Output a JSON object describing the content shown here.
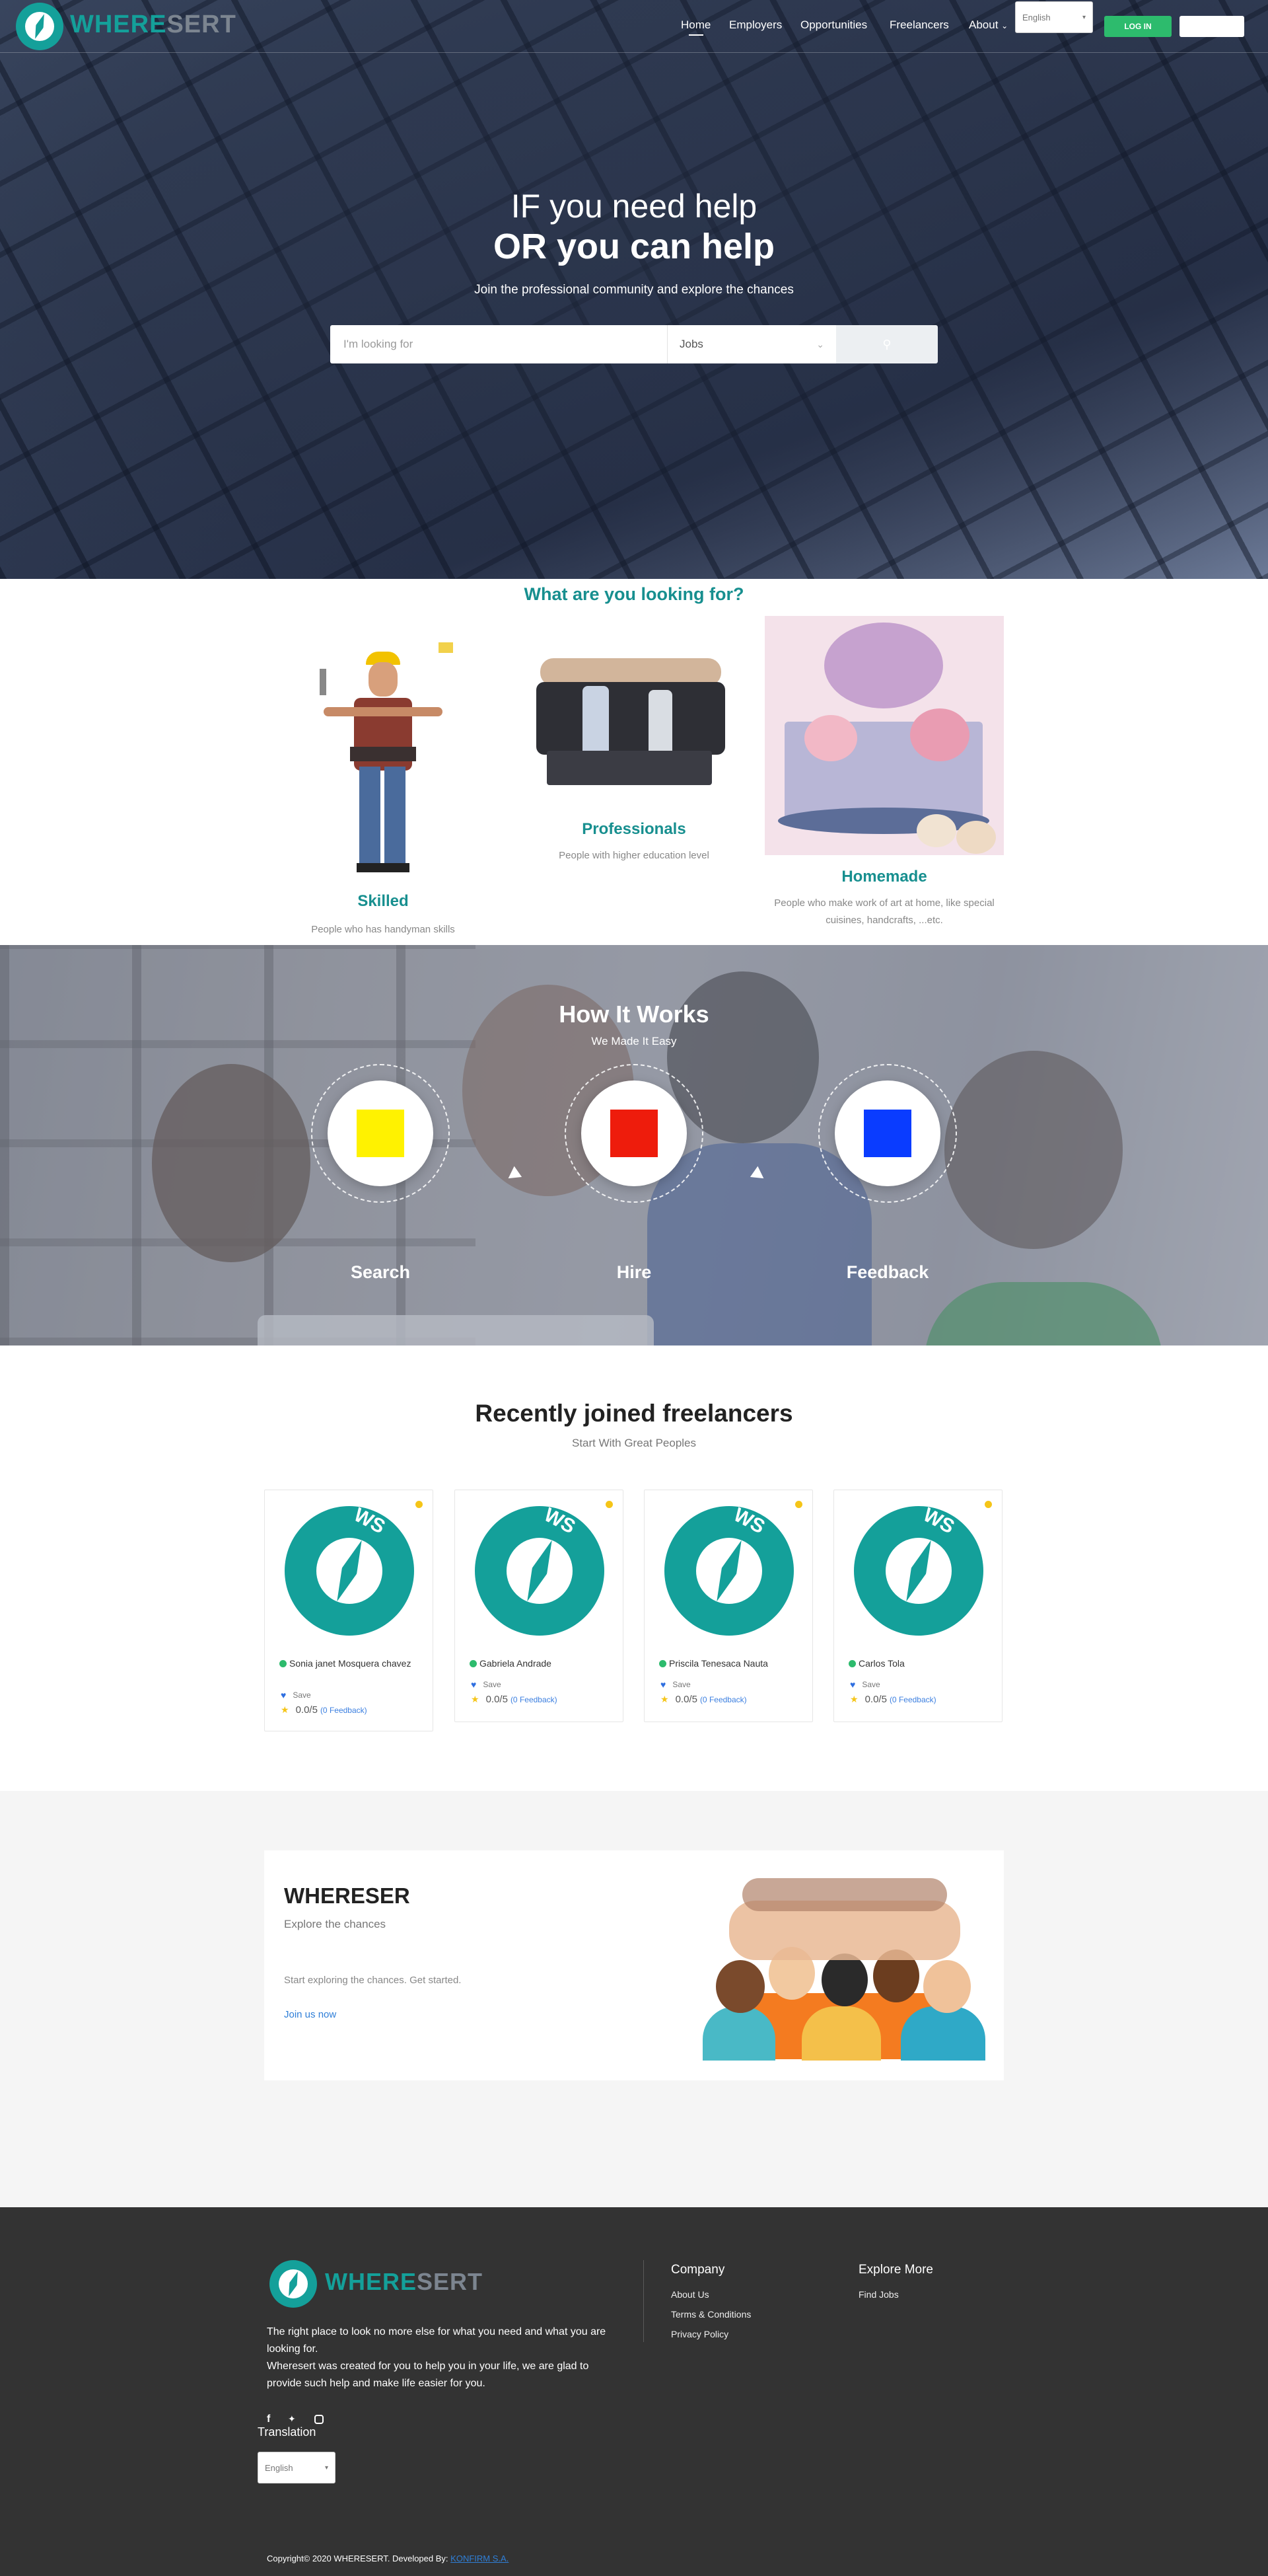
{
  "nav": {
    "brand_w": "WHERE",
    "brand_s": "SERT",
    "links": [
      "Home",
      "Employers",
      "Opportunities",
      "Freelancers",
      "About"
    ],
    "language": "English",
    "login_label": "LOG IN"
  },
  "hero": {
    "title_line1": "IF you need help",
    "title_line2": "OR you can help",
    "subtitle": "Join the professional community and explore the chances",
    "search_placeholder": "I'm looking for",
    "search_category": "Jobs"
  },
  "looking": {
    "title": "What are you looking for?",
    "categories": [
      {
        "title": "Skilled",
        "desc": "People who has handyman skills"
      },
      {
        "title": "Professionals",
        "desc": "People with higher education level"
      },
      {
        "title": "Homemade",
        "desc": "People who make work of art at home, like special cuisines, handcrafts, ...etc."
      }
    ]
  },
  "how": {
    "title": "How It Works",
    "subtitle": "We Made It Easy",
    "steps": [
      {
        "label": "Search",
        "color": "#fff200"
      },
      {
        "label": "Hire",
        "color": "#ee1c0c"
      },
      {
        "label": "Feedback",
        "color": "#0a3cff"
      }
    ]
  },
  "freelancers": {
    "title": "Recently joined freelancers",
    "subtitle": "Start With Great Peoples",
    "avatar_text": "WS",
    "save_label": "Save",
    "feedback_label": "(0 Feedback)",
    "items": [
      {
        "name": "Sonia janet Mosquera chavez",
        "rating": "0.0/5"
      },
      {
        "name": "Gabriela Andrade",
        "rating": "0.0/5"
      },
      {
        "name": "Priscila Tenesaca Nauta",
        "rating": "0.0/5"
      },
      {
        "name": "Carlos Tola",
        "rating": "0.0/5"
      }
    ]
  },
  "cta": {
    "title": "WHERESER",
    "subtitle": "Explore the chances",
    "text": "Start exploring the chances. Get started.",
    "link": "Join us now"
  },
  "footer": {
    "brand_w": "WHERE",
    "brand_s": "SERT",
    "about_p1": "The right place to look no more else for what you need and what you are looking for.",
    "about_p2": "Wheresert was created for you to help you in your life, we are glad to provide such help and make life easier for you.",
    "translation_label": "Translation",
    "language": "English",
    "company_title": "Company",
    "company_links": [
      "About Us",
      "Terms & Conditions",
      "Privacy Policy"
    ],
    "explore_title": "Explore More",
    "explore_links": [
      "Find Jobs"
    ],
    "copyright": "Copyright© 2020 WHERESERT. Developed By:",
    "developer": "KONFIRM S.A."
  }
}
